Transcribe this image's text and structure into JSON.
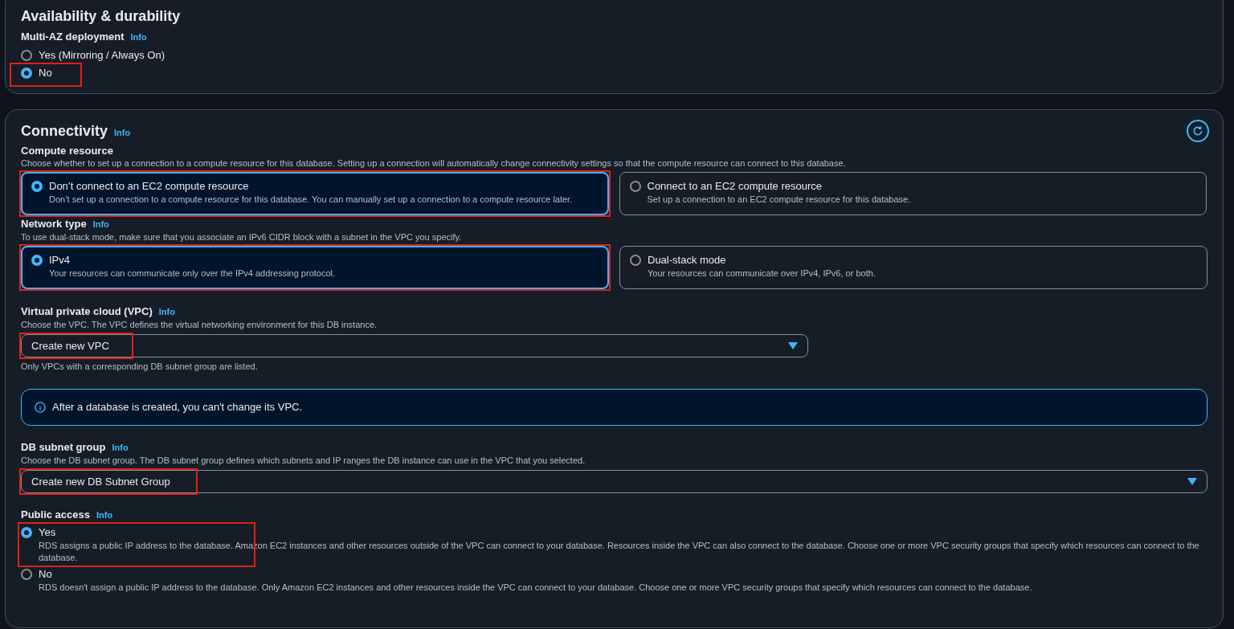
{
  "availability": {
    "title": "Availability & durability",
    "multi_az": {
      "label": "Multi-AZ deployment",
      "info": "Info",
      "options": [
        {
          "label": "Yes (Mirroring / Always On)",
          "selected": false,
          "highlighted": false
        },
        {
          "label": "No",
          "selected": true,
          "highlighted": true
        }
      ]
    }
  },
  "connectivity": {
    "title": "Connectivity",
    "info": "Info",
    "compute_resource": {
      "label": "Compute resource",
      "description": "Choose whether to set up a connection to a compute resource for this database. Setting up a connection will automatically change connectivity settings so that the compute resource can connect to this database.",
      "options": [
        {
          "label": "Don’t connect to an EC2 compute resource",
          "description": "Don’t set up a connection to a compute resource for this database. You can manually set up a connection to a compute resource later.",
          "selected": true,
          "highlighted": true
        },
        {
          "label": "Connect to an EC2 compute resource",
          "description": "Set up a connection to an EC2 compute resource for this database.",
          "selected": false,
          "highlighted": false
        }
      ]
    },
    "network_type": {
      "label": "Network type",
      "info": "Info",
      "description": "To use dual-stack mode, make sure that you associate an IPv6 CIDR block with a subnet in the VPC you specify.",
      "options": [
        {
          "label": "IPv4",
          "description": "Your resources can communicate only over the IPv4 addressing protocol.",
          "selected": true,
          "highlighted": true
        },
        {
          "label": "Dual-stack mode",
          "description": "Your resources can communicate over IPv4, IPv6, or both.",
          "selected": false,
          "highlighted": false
        }
      ]
    },
    "vpc": {
      "label": "Virtual private cloud (VPC)",
      "info": "Info",
      "description": "Choose the VPC. The VPC defines the virtual networking environment for this DB instance.",
      "select": {
        "value": "Create new VPC",
        "highlighted": true
      },
      "help": "Only VPCs with a corresponding DB subnet group are listed."
    },
    "alert": {
      "text": "After a database is created, you can't change its VPC."
    },
    "db_subnet_group": {
      "label": "DB subnet group",
      "info": "Info",
      "description": "Choose the DB subnet group. The DB subnet group defines which subnets and IP ranges the DB instance can use in the VPC that you selected.",
      "select": {
        "value": "Create new DB Subnet Group",
        "highlighted": true
      }
    },
    "public_access": {
      "label": "Public access",
      "info": "Info",
      "options": [
        {
          "label": "Yes",
          "description": "RDS assigns a public IP address to the database. Amazon EC2 instances and other resources outside of the VPC can connect to your database. Resources inside the VPC can also connect to the database. Choose one or more VPC security groups that specify which resources can connect to the database.",
          "selected": true,
          "highlighted": true
        },
        {
          "label": "No",
          "description": "RDS doesn't assign a public IP address to the database. Only Amazon EC2 instances and other resources inside the VPC can connect to your database. Choose one or more VPC security groups that specify which resources can connect to the database.",
          "selected": false,
          "highlighted": false
        }
      ]
    }
  }
}
